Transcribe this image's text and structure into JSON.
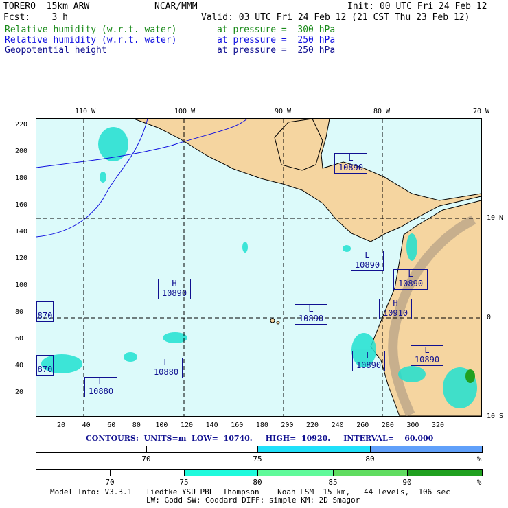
{
  "header": {
    "model": "TORERO  15km ARW",
    "org": "NCAR/MMM",
    "init": "Init: 00 UTC Fri 24 Feb 12",
    "fcst": "Fcst:    3 h",
    "valid": "Valid: 03 UTC Fri 24 Feb 12 (21 CST Thu 23 Feb 12)"
  },
  "fields": [
    {
      "name": "Relative humidity (w.r.t. water)",
      "level": "at pressure =  300 hPa",
      "color": "#1a8a1a"
    },
    {
      "name": "Relative humidity (w.r.t. water)",
      "level": "at pressure =  250 hPa",
      "color": "#1010e0"
    },
    {
      "name": "Geopotential height",
      "level": "at pressure =  250 hPa",
      "color": "#101090"
    }
  ],
  "top_axis": [
    "110 W",
    "100 W",
    "90 W",
    "80 W",
    "70 W"
  ],
  "right_axis": [
    "10 N",
    "0",
    "10 S"
  ],
  "left_axis": [
    "220",
    "200",
    "180",
    "160",
    "140",
    "120",
    "100",
    "80",
    "60",
    "40",
    "20"
  ],
  "bottom_axis": [
    "20",
    "40",
    "60",
    "80",
    "100",
    "120",
    "140",
    "160",
    "180",
    "200",
    "220",
    "240",
    "260",
    "280",
    "300",
    "320"
  ],
  "labels": [
    {
      "type": "L",
      "value": "10890"
    },
    {
      "type": "L",
      "value": "10890"
    },
    {
      "type": "L",
      "value": "10890"
    },
    {
      "type": "H",
      "value": "10890"
    },
    {
      "type": "H",
      "value": "10910"
    },
    {
      "type": "L",
      "value": "10890"
    },
    {
      "type": "",
      "value": "870"
    },
    {
      "type": "L",
      "value": "10890"
    },
    {
      "type": "L",
      "value": "10890"
    },
    {
      "type": "L",
      "value": "10880"
    },
    {
      "type": "",
      "value": "870"
    },
    {
      "type": "L",
      "value": "10880"
    }
  ],
  "contours": "CONTOURS:  UNITS=m  LOW=  10740.     HIGH=  10920.     INTERVAL=    60.000",
  "colorbar1": {
    "labels": [
      "70",
      "75",
      "80",
      "%"
    ],
    "colors": [
      "#ffffff",
      "#ffffff",
      "#20e0fa",
      "#60a0fa"
    ]
  },
  "colorbar2": {
    "labels": [
      "70",
      "75",
      "80",
      "85",
      "90",
      "%"
    ],
    "colors": [
      "#ffffff",
      "#ffffff",
      "#20fadc",
      "#60fa9a",
      "#60dc60",
      "#20a020"
    ]
  },
  "footer": {
    "line1": "Model Info: V3.3.1   Tiedtke YSU PBL  Thompson    Noah LSM  15 km,   44 levels,  106 sec",
    "line2": "LW: Godd SW: Goddard DIFF: simple KM: 2D Smagor"
  }
}
